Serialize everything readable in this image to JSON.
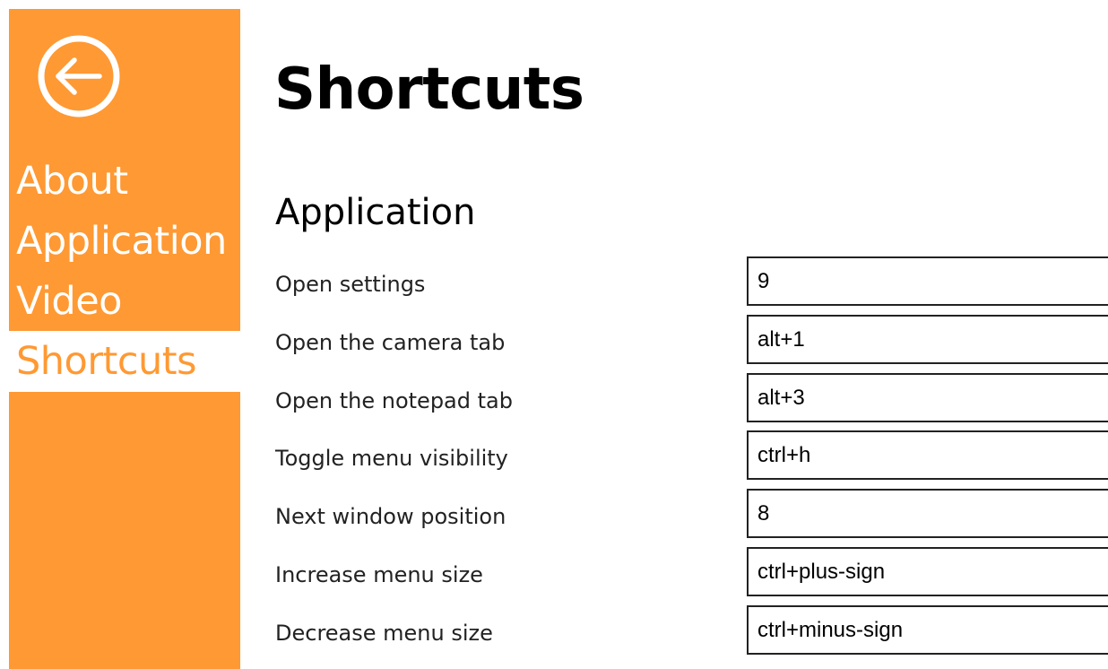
{
  "accent_color": "#FF9933",
  "back_button": {
    "icon": "back-arrow-icon"
  },
  "sidebar": {
    "items": [
      {
        "label": "About",
        "active": false
      },
      {
        "label": "Application",
        "active": false
      },
      {
        "label": "Video",
        "active": false
      },
      {
        "label": "Shortcuts",
        "active": true
      }
    ]
  },
  "page": {
    "title": "Shortcuts"
  },
  "section": {
    "title": "Application",
    "shortcuts": [
      {
        "label": "Open settings",
        "value": "9"
      },
      {
        "label": "Open the camera tab",
        "value": "alt+1"
      },
      {
        "label": "Open the notepad tab",
        "value": "alt+3"
      },
      {
        "label": "Toggle menu visibility",
        "value": "ctrl+h"
      },
      {
        "label": "Next window position",
        "value": "8"
      },
      {
        "label": "Increase menu size",
        "value": "ctrl+plus-sign"
      },
      {
        "label": "Decrease menu size",
        "value": "ctrl+minus-sign"
      }
    ]
  }
}
